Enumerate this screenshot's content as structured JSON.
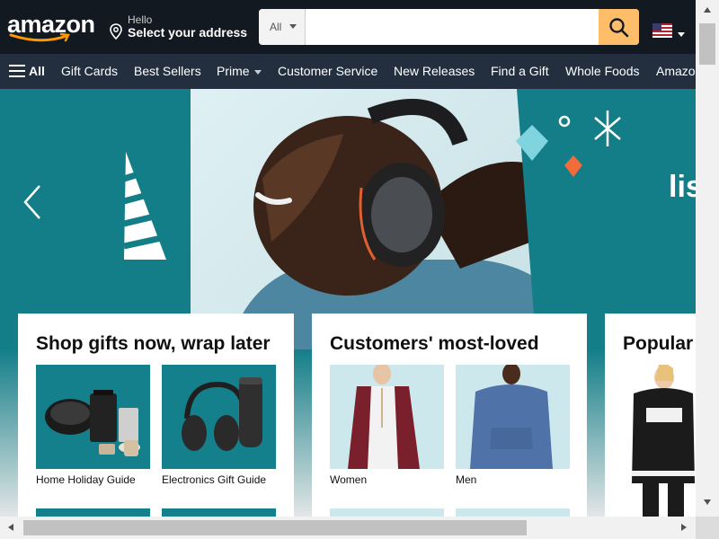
{
  "header": {
    "logo_text": "amazon",
    "address_hello": "Hello",
    "address_select": "Select your address",
    "search_category": "All",
    "search_placeholder": "",
    "flag_icon": "us-flag-icon"
  },
  "nav": {
    "all_label": "All",
    "items": [
      "Gift Cards",
      "Best Sellers",
      "Prime",
      "Customer Service",
      "New Releases",
      "Find a Gift",
      "Whole Foods",
      "Amazon"
    ]
  },
  "hero": {
    "partial_text": "lis"
  },
  "cards": [
    {
      "title": "Shop gifts now, wrap later",
      "tiles": [
        {
          "caption": "Home Holiday Guide"
        },
        {
          "caption": "Electronics Gift Guide"
        }
      ]
    },
    {
      "title": "Customers' most-loved",
      "tiles": [
        {
          "caption": "Women"
        },
        {
          "caption": "Men"
        }
      ]
    },
    {
      "title": "Popular"
    }
  ],
  "colors": {
    "header_bg": "#131921",
    "nav_bg": "#232f3e",
    "search_button": "#febd69",
    "hero_teal": "#137e88",
    "logo_smile": "#ff9900"
  }
}
